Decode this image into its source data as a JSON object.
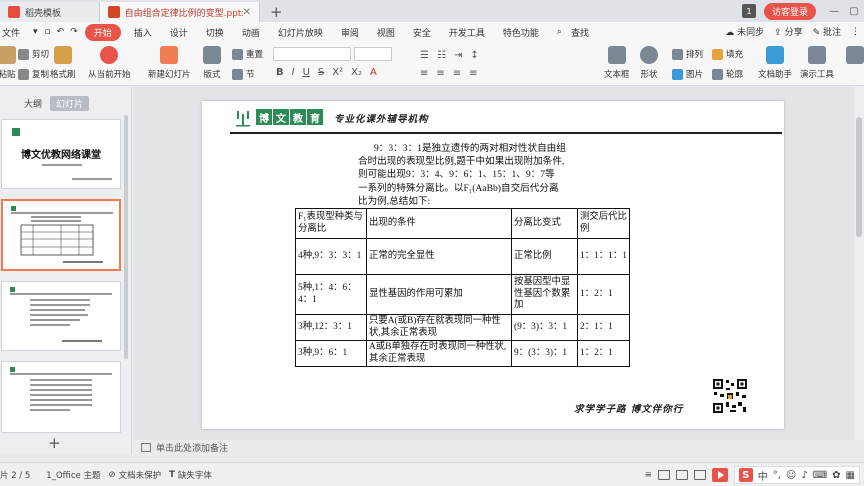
{
  "titlebar": {
    "tab_home": "稻壳模板",
    "tab_doc": "自由组合定律比例的变型.pptx",
    "counter": "1",
    "login": "访客登录"
  },
  "menubar": {
    "items": [
      "文件",
      "开始",
      "插入",
      "设计",
      "切换",
      "动画",
      "幻灯片放映",
      "审阅",
      "视图",
      "安全",
      "开发工具",
      "特色功能"
    ],
    "search": "查找",
    "sync": "未同步",
    "share": "分享",
    "comment": "批注"
  },
  "ribbon": {
    "cut": "剪切",
    "copy": "复制",
    "paste": "粘贴",
    "format_painter": "格式刷",
    "from_current": "从当前开始",
    "new_slide": "新建幻灯片",
    "layout": "版式",
    "section": "节",
    "reset": "重置",
    "textbox": "文本框",
    "shape": "形状",
    "picture": "图片",
    "fill": "填充",
    "arrange": "排列",
    "outline": "轮廓",
    "doc_assistant": "文档助手",
    "present_tools": "演示工具"
  },
  "leftpanel": {
    "tab_outline": "大纲",
    "tab_slides": "幻灯片",
    "thumb1_title": "博文优教网络课堂"
  },
  "slide": {
    "logo_chars": [
      "博",
      "文",
      "教",
      "育"
    ],
    "slogan": "专业化课外辅导机构",
    "paragraph": [
      "9：3：3：1是独立遗传的两对相对性状自由组",
      "合时出现的表现型比例,题干中如果出现附加条件,",
      "则可能出现9：3：4、9：6：1、15：1、9：7等",
      "一系列的特殊分离比。以F₁(AaBb)自交后代分离",
      "比为例,总结如下:"
    ],
    "table": {
      "headers": [
        "F₁表现型种类与分离比",
        "出现的条件",
        "分离比变式",
        "测交后代比例"
      ],
      "rows": [
        [
          "4种,9：3：3：1",
          "正常的完全显性",
          "正常比例",
          "1：1：1：1"
        ],
        [
          "5种,1：4：6：4：1",
          "显性基因的作用可累加",
          "按基因型中显性基因个数累加",
          "1：2：1"
        ],
        [
          "3种,12：3：1",
          "只要A(或B)存在就表现同一种性状,其余正常表现",
          "(9：3)：3：1",
          "2：1：1"
        ],
        [
          "3种,9：6：1",
          "A或B单独存在时表现同一种性状,其余正常表现",
          "9：(3：3)：1",
          "1：2：1"
        ]
      ]
    },
    "bottom_slogan": "求学学子路  博文伴你行"
  },
  "notes": {
    "placeholder": "单击此处添加备注"
  },
  "statusbar": {
    "page": "片 2 / 5",
    "theme": "1_Office 主题",
    "protect": "文档未保护",
    "font_missing": "缺失字体"
  },
  "ime": {
    "lang": "中"
  },
  "colors": {
    "accent": "#e8534a",
    "logo_green": "#2e8b57"
  }
}
